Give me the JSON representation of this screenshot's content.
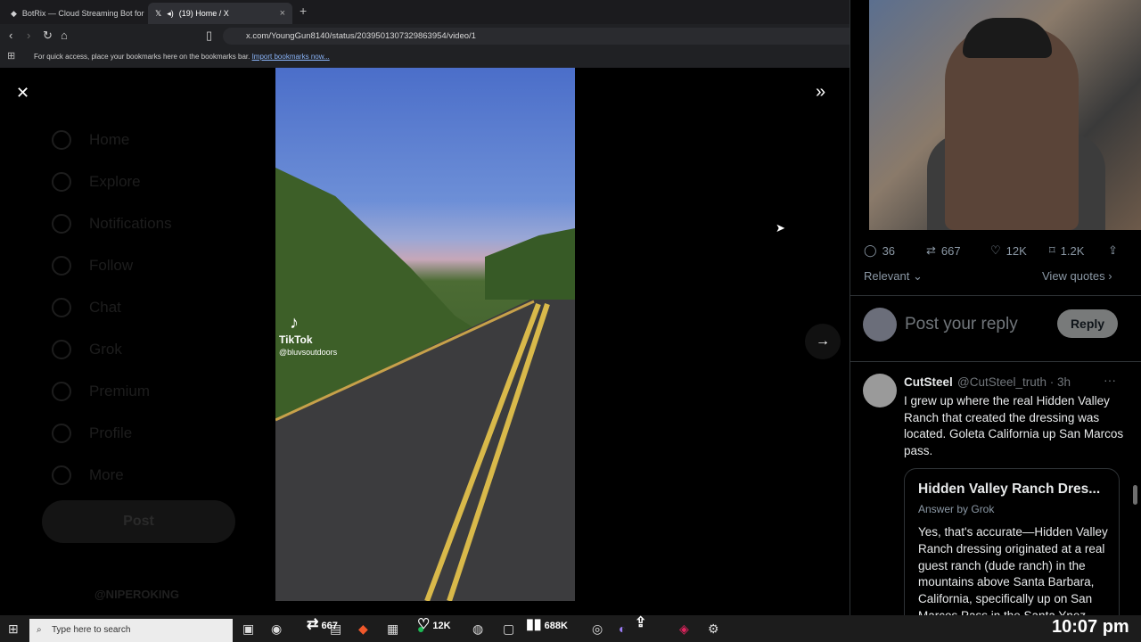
{
  "browser": {
    "tab1_title": "BotRix — Cloud Streaming Bot for Tw",
    "tab2_title": "(19) Home / X",
    "url": "x.com/YoungGun8140/status/2039501307329863954/video/1",
    "bookmarks_hint": "For quick access, place your bookmarks here on the bookmarks bar.",
    "bookmarks_link": "Import bookmarks now..."
  },
  "sidebar": {
    "items": [
      {
        "label": "Home",
        "icon": "home-icon"
      },
      {
        "label": "Explore",
        "icon": "search-icon"
      },
      {
        "label": "Notifications",
        "icon": "bell-icon"
      },
      {
        "label": "Follow",
        "icon": "follow-icon"
      },
      {
        "label": "Chat",
        "icon": "chat-icon"
      },
      {
        "label": "Grok",
        "icon": "grok-icon"
      },
      {
        "label": "Premium",
        "icon": "premium-icon"
      },
      {
        "label": "Profile",
        "icon": "profile-icon"
      },
      {
        "label": "More",
        "icon": "more-icon"
      }
    ],
    "post_label": "Post",
    "account": "@NIPEROKING"
  },
  "video": {
    "watermark": "TikTok",
    "handle": "@bluvsoutdoors"
  },
  "actions": {
    "replies": "36",
    "reposts": "667",
    "likes": "12K",
    "bookmarks": "1.2K"
  },
  "sort": {
    "relevant": "Relevant",
    "view_quotes": "View quotes"
  },
  "reply_box": {
    "placeholder": "Post your reply",
    "button": "Reply"
  },
  "comment": {
    "name": "CutSteel",
    "handle": "@CutSteel_truth · 3h",
    "text": "I grew up where the real Hidden Valley Ranch that created the dressing was located. Goleta California up San Marcos pass.",
    "grok_title": "Hidden Valley Ranch Dres...",
    "grok_sub": "Answer by Grok",
    "grok_text": "Yes, that's accurate—Hidden Valley Ranch dressing originated at a real guest ranch (dude ranch) in the mountains above Santa Barbara, California, specifically up on San Marcos Pass in the Santa Ynez Mountains area (near..."
  },
  "taskbar": {
    "search_placeholder": "Type here to search",
    "reposts_overlay": "667",
    "likes_overlay": "12K",
    "views_overlay": "688K",
    "time": "10:07 pm"
  }
}
